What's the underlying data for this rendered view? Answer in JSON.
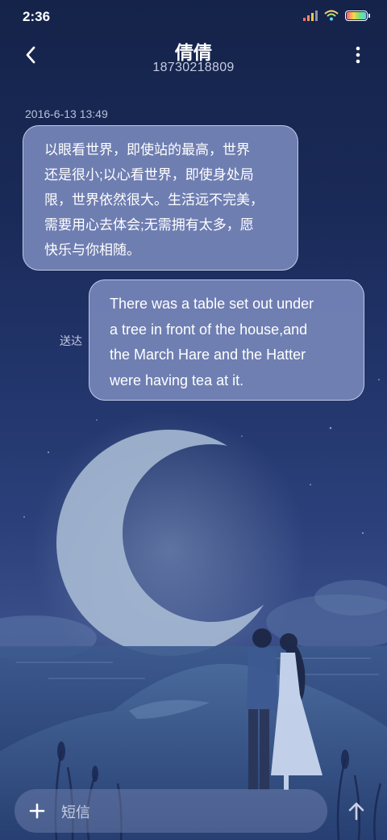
{
  "status_bar": {
    "time": "2:36",
    "icons": [
      "signal-icon",
      "wifi-icon",
      "battery-icon"
    ]
  },
  "header": {
    "contact_name": "倩倩",
    "contact_number": "18730218809",
    "back_icon": "chevron-left-icon",
    "more_icon": "more-vertical-icon"
  },
  "conversation": {
    "timestamp": "2016-6-13 13:49",
    "messages": [
      {
        "direction": "incoming",
        "lines": [
          "以眼看世界，即使站的最高，世界",
          "还是很小;以心看世界，即使身处局",
          "限，世界依然很大。生活远不完美，",
          "需要用心去体会;无需拥有太多，愿",
          "快乐与你相随。"
        ]
      },
      {
        "direction": "outgoing",
        "status": "送达",
        "lines": [
          "There was a table set out under",
          "a tree in front of the house,and",
          "the March Hare and the Hatter",
          "were having tea at it."
        ]
      }
    ]
  },
  "composer": {
    "placeholder": "短信",
    "add_icon": "plus-icon",
    "send_icon": "arrow-up-icon"
  },
  "colors": {
    "background_top": "#15234a",
    "background_mid": "#2b407a",
    "bubble_fill": "#7686b8",
    "bubble_border": "#cdd6f0",
    "moon": "#aabfd8"
  }
}
